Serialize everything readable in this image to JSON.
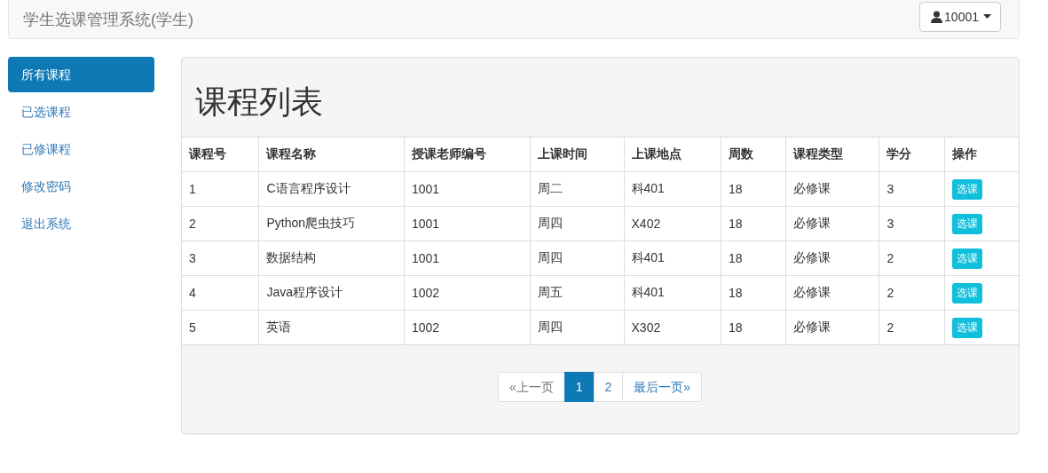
{
  "navbar": {
    "brand": "学生选课管理系统(学生)",
    "user_button": "10001"
  },
  "sidebar": {
    "items": [
      {
        "label": "所有课程",
        "selected": true
      },
      {
        "label": "已选课程",
        "selected": false
      },
      {
        "label": "已修课程",
        "selected": false
      },
      {
        "label": "修改密码",
        "selected": false
      },
      {
        "label": "退出系统",
        "selected": false
      }
    ]
  },
  "panel": {
    "title": "课程列表"
  },
  "table": {
    "columns": [
      "课程号",
      "课程名称",
      "授课老师编号",
      "上课时间",
      "上课地点",
      "周数",
      "课程类型",
      "学分",
      "操作"
    ],
    "rows": [
      [
        "1",
        "C语言程序设计",
        "1001",
        "周二",
        "科401",
        "18",
        "必修课",
        "3",
        "选课"
      ],
      [
        "2",
        "Python爬虫技巧",
        "1001",
        "周四",
        "X402",
        "18",
        "必修课",
        "3",
        "选课"
      ],
      [
        "3",
        "数据结构",
        "1001",
        "周四",
        "科401",
        "18",
        "必修课",
        "2",
        "选课"
      ],
      [
        "4",
        "Java程序设计",
        "1002",
        "周五",
        "科401",
        "18",
        "必修课",
        "2",
        "选课"
      ],
      [
        "5",
        "英语",
        "1002",
        "周四",
        "X302",
        "18",
        "必修课",
        "2",
        "选课"
      ]
    ]
  },
  "pagination": [
    {
      "label": "«上一页",
      "selected": false,
      "disabled": true
    },
    {
      "label": "1",
      "selected": true,
      "disabled": false
    },
    {
      "label": "2",
      "selected": false,
      "disabled": false
    },
    {
      "label": "最后一页»",
      "selected": false,
      "disabled": false
    }
  ]
}
